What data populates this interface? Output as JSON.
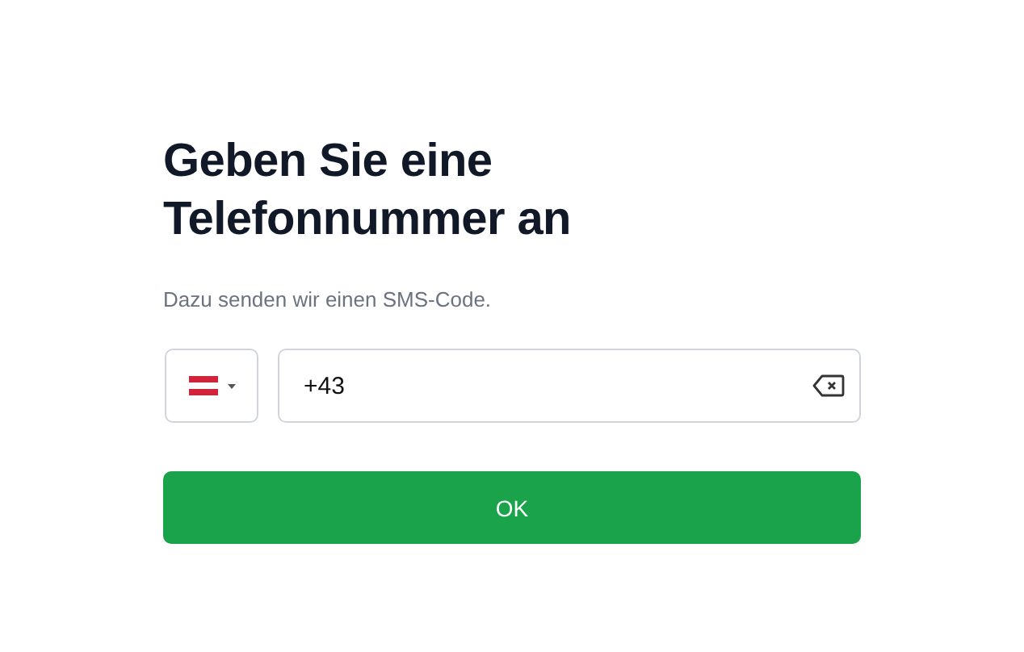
{
  "title": "Geben Sie eine Telefonnummer an",
  "subtitle": "Dazu senden wir einen SMS-Code.",
  "phone": {
    "value": "+43"
  },
  "button": "OK"
}
